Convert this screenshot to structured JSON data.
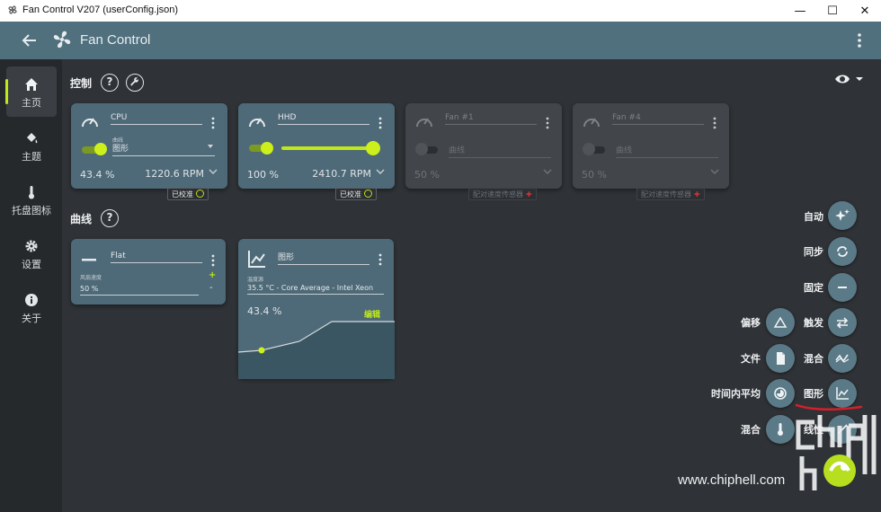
{
  "window": {
    "title": "Fan Control V207 (userConfig.json)",
    "minimize": "—",
    "maximize": "☐",
    "close": "✕"
  },
  "header": {
    "title": "Fan Control"
  },
  "sidebar": {
    "items": [
      {
        "label": "主页",
        "icon": "home-icon"
      },
      {
        "label": "主题",
        "icon": "paint-bucket-icon"
      },
      {
        "label": "托盘图标",
        "icon": "thermometer-icon"
      },
      {
        "label": "设置",
        "icon": "gear-icon"
      },
      {
        "label": "关于",
        "icon": "info-icon"
      }
    ]
  },
  "controls": {
    "section_title": "控制",
    "help": "?",
    "cards": [
      {
        "name": "CPU",
        "mode_label": "曲线",
        "mode": "图形",
        "percent": "43.4 %",
        "rpm": "1220.6 RPM",
        "badge": "已校准",
        "enabled": true
      },
      {
        "name": "HHD",
        "percent": "100 %",
        "rpm": "2410.7 RPM",
        "badge": "已校准",
        "enabled": true
      },
      {
        "name": "Fan #1",
        "mode": "曲线",
        "percent": "50 %",
        "rpm": "",
        "badge": "配对速度传感器",
        "enabled": false
      },
      {
        "name": "Fan #4",
        "mode": "曲线",
        "percent": "50 %",
        "rpm": "",
        "badge": "配对速度传感器",
        "enabled": false
      }
    ]
  },
  "curves": {
    "section_title": "曲线",
    "help": "?",
    "flat": {
      "name": "Flat",
      "label": "风扇速度",
      "value": "50 %",
      "plus": "+",
      "minus": "-"
    },
    "graph": {
      "name": "图形",
      "source_label": "温度源",
      "source": "35.5 °C - Core Average - Intel Xeon",
      "percent": "43.4 %",
      "edit": "编辑"
    }
  },
  "fab": {
    "auto": "自动",
    "sync": "同步",
    "fixed": "固定",
    "offset": "偏移",
    "trigger": "触发",
    "file": "文件",
    "mix": "混合",
    "time_avg": "时间内平均",
    "graph": "图形",
    "mix2": "混合",
    "linear": "线性"
  },
  "watermark": {
    "text": "www.chiphell.com"
  }
}
